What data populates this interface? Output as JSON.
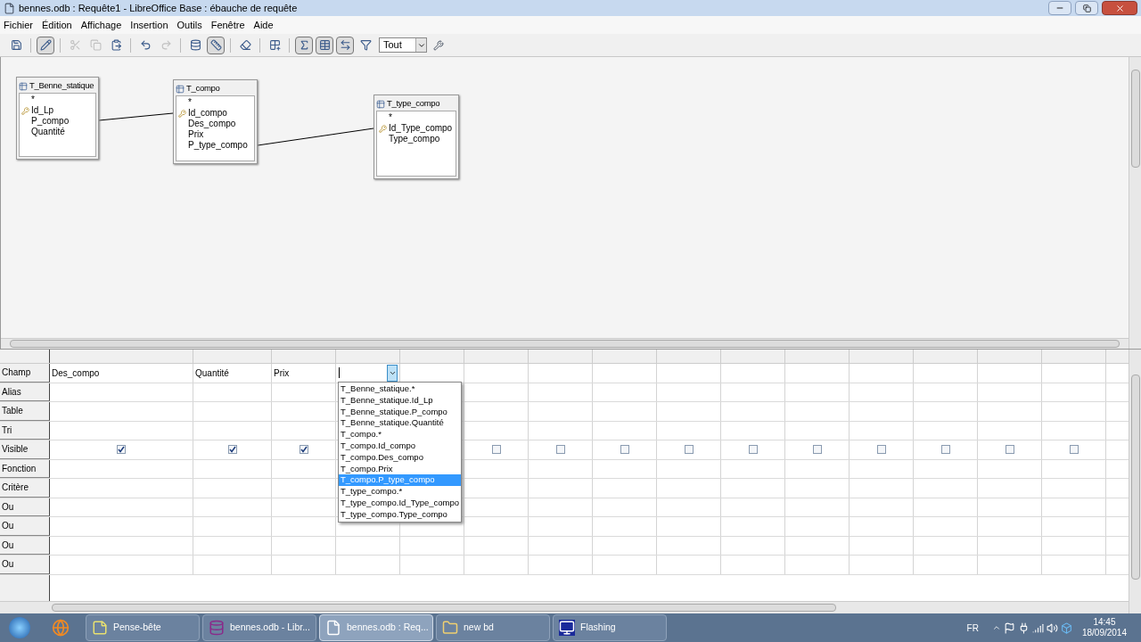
{
  "window": {
    "title": "bennes.odb : Requête1 - LibreOffice Base : ébauche de requête"
  },
  "menu": [
    "Fichier",
    "Édition",
    "Affichage",
    "Insertion",
    "Outils",
    "Fenêtre",
    "Aide"
  ],
  "toolbar": [
    {
      "kind": "save",
      "pressed": false,
      "disabled": false
    },
    {
      "kind": "edit",
      "pressed": true,
      "disabled": false
    },
    {
      "kind": "cut",
      "pressed": false,
      "disabled": true
    },
    {
      "kind": "copy",
      "pressed": false,
      "disabled": true
    },
    {
      "kind": "paste",
      "pressed": false,
      "disabled": false
    },
    {
      "kind": "undo",
      "pressed": false,
      "disabled": false
    },
    {
      "kind": "redo",
      "pressed": false,
      "disabled": true
    },
    {
      "kind": "run",
      "pressed": false,
      "disabled": false
    },
    {
      "kind": "design",
      "pressed": true,
      "disabled": false
    },
    {
      "kind": "clear",
      "pressed": false,
      "disabled": false
    },
    {
      "kind": "addtable",
      "pressed": false,
      "disabled": false
    },
    {
      "kind": "functions",
      "pressed": true,
      "disabled": false
    },
    {
      "kind": "tablename",
      "pressed": true,
      "disabled": false
    },
    {
      "kind": "alias",
      "pressed": true,
      "disabled": false
    },
    {
      "kind": "distinct",
      "pressed": false,
      "disabled": false
    }
  ],
  "limit": {
    "value": "Tout"
  },
  "tables": [
    {
      "title": "T_Benne_statique",
      "fields": [
        {
          "name": "*",
          "key": false
        },
        {
          "name": "Id_Lp",
          "key": true
        },
        {
          "name": "P_compo",
          "key": false
        },
        {
          "name": "Quantité",
          "key": false
        }
      ]
    },
    {
      "title": "T_compo",
      "fields": [
        {
          "name": "*",
          "key": false
        },
        {
          "name": "Id_compo",
          "key": true
        },
        {
          "name": "Des_compo",
          "key": false
        },
        {
          "name": "Prix",
          "key": false
        },
        {
          "name": "P_type_compo",
          "key": false
        }
      ]
    },
    {
      "title": "T_type_compo",
      "fields": [
        {
          "name": "*",
          "key": false
        },
        {
          "name": "Id_Type_compo",
          "key": true
        },
        {
          "name": "Type_compo",
          "key": false
        }
      ]
    }
  ],
  "row_labels": [
    "Champ",
    "Alias",
    "Table",
    "Tri",
    "Visible",
    "Fonction",
    "Critère",
    "Ou",
    "Ou",
    "Ou",
    "Ou"
  ],
  "columns": [
    {
      "field": "Des_compo",
      "visible": true
    },
    {
      "field": "Quantité",
      "visible": true
    },
    {
      "field": "Prix",
      "visible": true
    },
    {
      "kind": "combo"
    },
    {},
    {
      "visible": false
    },
    {
      "visible": false
    },
    {
      "visible": false
    },
    {
      "visible": false
    },
    {
      "visible": false
    },
    {
      "visible": false
    },
    {
      "visible": false
    },
    {
      "visible": false
    },
    {
      "visible": false
    },
    {
      "visible": false
    }
  ],
  "dropdown": {
    "items": [
      {
        "label": "T_Benne_statique.*",
        "selected": false
      },
      {
        "label": "T_Benne_statique.Id_Lp",
        "selected": false
      },
      {
        "label": "T_Benne_statique.P_compo",
        "selected": false
      },
      {
        "label": "T_Benne_statique.Quantité",
        "selected": false
      },
      {
        "label": "T_compo.*",
        "selected": false
      },
      {
        "label": "T_compo.Id_compo",
        "selected": false
      },
      {
        "label": "T_compo.Des_compo",
        "selected": false
      },
      {
        "label": "T_compo.Prix",
        "selected": false
      },
      {
        "label": "T_compo.P_type_compo",
        "selected": true
      },
      {
        "label": "T_type_compo.*",
        "selected": false
      },
      {
        "label": "T_type_compo.Id_Type_compo",
        "selected": false
      },
      {
        "label": "T_type_compo.Type_compo",
        "selected": false
      }
    ]
  },
  "taskbar": {
    "items": [
      {
        "label": "Pense-bête",
        "active": false
      },
      {
        "label": "bennes.odb - Libr...",
        "active": false
      },
      {
        "label": "bennes.odb : Req...",
        "active": true
      },
      {
        "label": "new bd",
        "active": false
      },
      {
        "label": "Flashing",
        "active": false
      }
    ],
    "language": "FR",
    "time": "14:45",
    "date": "18/09/2014"
  }
}
